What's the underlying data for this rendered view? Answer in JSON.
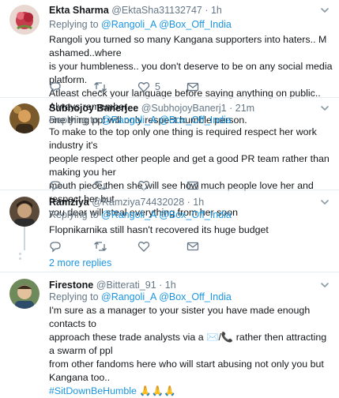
{
  "tweets": [
    {
      "name": "Ekta Sharma",
      "handle": "@EktaSha31132747",
      "time": "· 1h",
      "replying_prefix": "Replying to ",
      "mentions": [
        "@Rangoli_A",
        "@Box_Off_India"
      ],
      "lines": [
        "Rangoli you turned so many Kangana supporters into haters.. M ashamed..where",
        "is your humbleness.. you don't deserve to be on any social media platform.",
        "Atleast check your language before saying anything on public.. Always remember",
        "one thing ppl will only respect humble   person."
      ],
      "actions": {
        "reply": "",
        "retweet": "",
        "like": "5",
        "dm": ""
      }
    },
    {
      "name": "Subhojoy Banerjee",
      "handle": "@SubhojoyBanerj1",
      "time": "· 21m",
      "replying_prefix": "Replying to ",
      "mentions": [
        "@Rangoli_A",
        "@Box_Off_India"
      ],
      "lines": [
        "To make to the top only one thing is required respect her work industry it's",
        "people respect other people and get a good PR team rather than making you her",
        "mouth piece then she will see how much people love her and respect her but",
        "you dear will steal everything from her soon"
      ],
      "actions": {
        "reply": "",
        "retweet": "",
        "like": "",
        "dm": ""
      }
    },
    {
      "name": "Ramziya",
      "handle": "@Ramziya74432028",
      "time": "· 1h",
      "replying_prefix": "Replying to ",
      "mentions": [
        "@Rangoli_A",
        "@Box_Off_India"
      ],
      "lines": [
        "Flopnikarnika still hasn't recovered its huge budget"
      ],
      "actions": {
        "reply": "",
        "retweet": "",
        "like": "",
        "dm": ""
      }
    },
    {
      "name": "Firestone",
      "handle": "@Bitterati_91",
      "time": "· 1h",
      "replying_prefix": "Replying to ",
      "mentions": [
        "@Rangoli_A",
        "@Box_Off_India"
      ],
      "lines": [
        "I'm sure as a manager to your sister you have made enough contacts to",
        "approach these trade analysts via a ✉️/📞 rather then attracting a swarm of ppl",
        "from other fandoms here who will start abusing not only you but Kangana too..",
        "#SitDownBeHumble 🙏🙏🙏"
      ],
      "actions": {
        "reply": "",
        "retweet": "",
        "like": "",
        "dm": ""
      }
    }
  ],
  "more_replies": "2 more replies",
  "icons": {
    "reply": "reply-icon",
    "retweet": "retweet-icon",
    "like": "heart-icon",
    "dm": "envelope-icon",
    "caret": "chevron-down-icon"
  },
  "colors": {
    "link": "#1b95e0",
    "muted": "#657786",
    "text": "#14171a",
    "divider": "#e6ecf0"
  }
}
